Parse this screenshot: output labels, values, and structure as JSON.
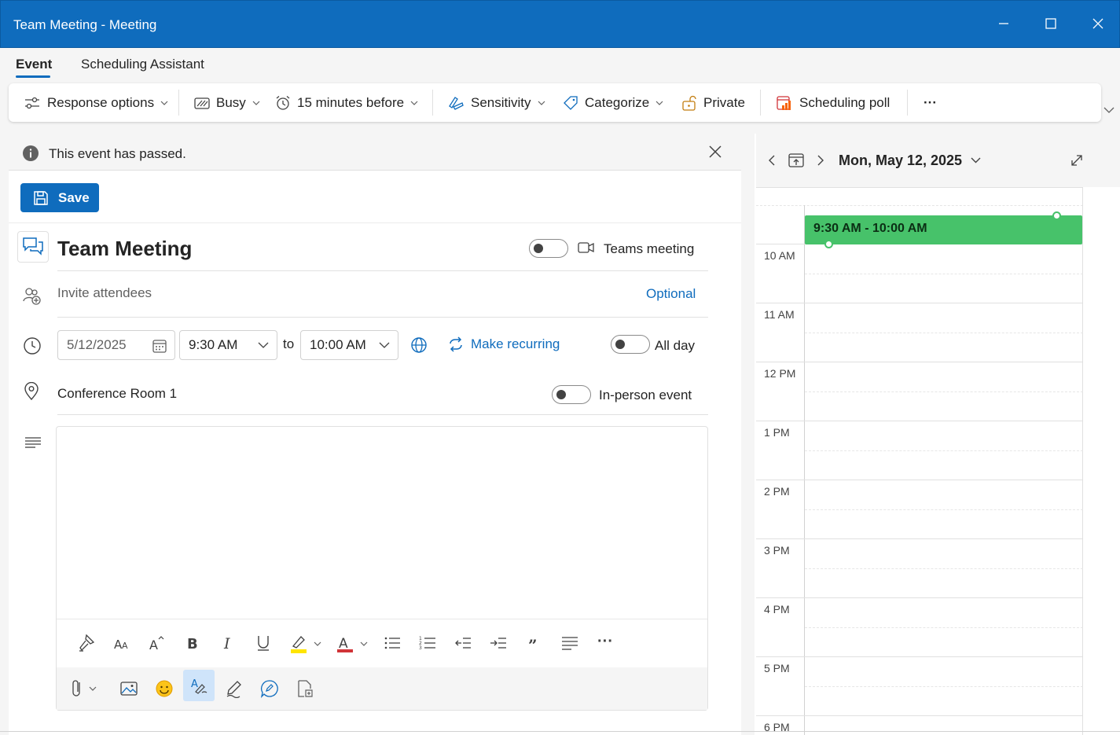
{
  "window": {
    "title": "Team Meeting - Meeting"
  },
  "tabs": [
    {
      "label": "Event"
    },
    {
      "label": "Scheduling Assistant"
    }
  ],
  "ribbon": {
    "response_options": "Response options",
    "show_as": "Busy",
    "reminder": "15 minutes before",
    "sensitivity": "Sensitivity",
    "categorize": "Categorize",
    "private": "Private",
    "scheduling_poll": "Scheduling poll",
    "more": "···"
  },
  "banner": {
    "text": "This event has passed."
  },
  "save_label": "Save",
  "event": {
    "title": "Team Meeting",
    "teams_meeting_label": "Teams meeting",
    "attendees_placeholder": "Invite attendees",
    "optional_label": "Optional",
    "date": "5/12/2025",
    "start_time": "9:30 AM",
    "to_label": "to",
    "end_time": "10:00 AM",
    "make_recurring": "Make recurring",
    "all_day_label": "All day",
    "location": "Conference Room 1",
    "in_person_label": "In-person event"
  },
  "editor": {
    "more": "···"
  },
  "calendar": {
    "date_label": "Mon, May 12, 2025",
    "hours": [
      "10 AM",
      "11 AM",
      "12 PM",
      "1 PM",
      "2 PM",
      "3 PM",
      "4 PM",
      "5 PM",
      "6 PM"
    ],
    "event_time": "9:30 AM - 10:00 AM",
    "event_color": "#47c26a"
  },
  "colors": {
    "accent": "#0f6cbd",
    "highlight": "#ffe500",
    "font_color": "#d13438"
  }
}
